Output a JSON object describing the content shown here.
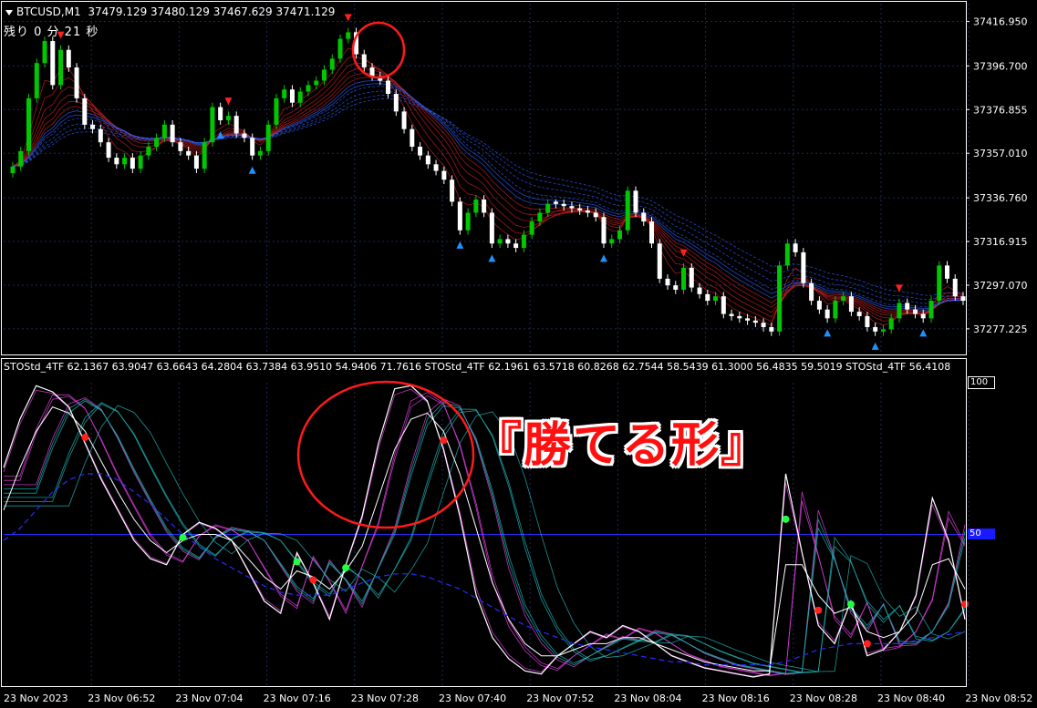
{
  "header": {
    "symbol": "BTCUSD,M1",
    "ohlc": "37479.129 37480.129 37467.629 37471.129",
    "timer": "残り 0 分 21 秒"
  },
  "indicator_header": {
    "text": "STOStd_4TF 62.1367 63.9047 63.6643 64.2804 63.7384 63.9510 54.9406 71.7616   STOStd_4TF 62.1961 63.5718 60.8268 62.7544 58.5439 61.3000 56.4835 59.5019   STOStd_4TF 56.4108"
  },
  "callout": {
    "text": "『勝てる形』"
  },
  "colors": {
    "bull_candle": "#00c800",
    "bear_candle": "#ffffff",
    "bear_ribbon": "#d02020",
    "bull_ribbon": "#3060ff",
    "osc_magenta": "#e040e0",
    "osc_teal": "#20b0b0",
    "sell_arrow": "#ff2020",
    "buy_arrow": "#2090ff",
    "grid": "#1c2a5a",
    "highlight_circle": "#ff1a1a"
  },
  "chart_data": [
    {
      "type": "candlestick",
      "title": "BTCUSD,M1",
      "ylim": [
        37266,
        37425
      ],
      "y_ticks": [
        "37416.950",
        "37396.700",
        "37376.855",
        "37357.010",
        "37336.760",
        "37316.915",
        "37297.070",
        "37277.225"
      ],
      "y_tick_values": [
        37416.95,
        37396.7,
        37376.855,
        37357.01,
        37336.76,
        37316.915,
        37297.07,
        37277.225
      ],
      "x_ticks": [
        "23 Nov 2023",
        "23 Nov 06:52",
        "23 Nov 07:04",
        "23 Nov 07:16",
        "23 Nov 07:28",
        "23 Nov 07:40",
        "23 Nov 07:52",
        "23 Nov 08:04",
        "23 Nov 08:16",
        "23 Nov 08:28",
        "23 Nov 08:40",
        "23 Nov 08:52"
      ],
      "close": [
        37351,
        37358,
        37382,
        37398,
        37408,
        37388,
        37404,
        37396,
        37382,
        37370,
        37368,
        37362,
        37355,
        37352,
        37355,
        37350,
        37356,
        37360,
        37364,
        37370,
        37362,
        37358,
        37356,
        37350,
        37362,
        37378,
        37372,
        37374,
        37366,
        37364,
        37356,
        37358,
        37370,
        37382,
        37386,
        37380,
        37385,
        37388,
        37390,
        37395,
        37400,
        37409,
        37412,
        37402,
        37396,
        37392,
        37390,
        37384,
        37376,
        37368,
        37360,
        37356,
        37352,
        37349,
        37345,
        37335,
        37322,
        37330,
        37336,
        37330,
        37316,
        37318,
        37316,
        37314,
        37320,
        37326,
        37330,
        37334,
        37334,
        37333,
        37332,
        37331,
        37330,
        37328,
        37316,
        37318,
        37322,
        37340,
        37330,
        37326,
        37316,
        37300,
        37297,
        37295,
        37305,
        37296,
        37293,
        37290,
        37292,
        37284,
        37283,
        37282,
        37281,
        37280,
        37278,
        37276,
        37306,
        37316,
        37312,
        37298,
        37290,
        37286,
        37282,
        37290,
        37292,
        37285,
        37283,
        37278,
        37276,
        37277,
        37282,
        37289,
        37286,
        37284,
        37282,
        37290,
        37306,
        37300,
        37292,
        37290
      ],
      "direction": [
        "bull",
        "bull",
        "bull",
        "bull",
        "bull",
        "bear",
        "bull",
        "bear",
        "bear",
        "bear",
        "bear",
        "bear",
        "bear",
        "bear",
        "bull",
        "bear",
        "bull",
        "bull",
        "bull",
        "bull",
        "bear",
        "bear",
        "bear",
        "bear",
        "bull",
        "bull",
        "bear",
        "bull",
        "bear",
        "bear",
        "bear",
        "bull",
        "bull",
        "bull",
        "bull",
        "bear",
        "bull",
        "bull",
        "bull",
        "bull",
        "bull",
        "bull",
        "bull",
        "bear",
        "bear",
        "bear",
        "bear",
        "bear",
        "bear",
        "bear",
        "bear",
        "bear",
        "bear",
        "bear",
        "bear",
        "bear",
        "bear",
        "bull",
        "bull",
        "bear",
        "bear",
        "bull",
        "bear",
        "bear",
        "bull",
        "bull",
        "bull",
        "bull",
        "bear",
        "bear",
        "bear",
        "bear",
        "bear",
        "bear",
        "bear",
        "bull",
        "bull",
        "bull",
        "bear",
        "bear",
        "bear",
        "bear",
        "bear",
        "bear",
        "bull",
        "bear",
        "bear",
        "bear",
        "bull",
        "bear",
        "bear",
        "bear",
        "bear",
        "bear",
        "bear",
        "bear",
        "bull",
        "bull",
        "bear",
        "bear",
        "bear",
        "bear",
        "bear",
        "bull",
        "bull",
        "bear",
        "bear",
        "bear",
        "bear",
        "bull",
        "bull",
        "bull",
        "bear",
        "bear",
        "bear",
        "bull",
        "bull",
        "bear",
        "bear",
        "bear"
      ]
    },
    {
      "type": "line",
      "title": "STOStd_4TF",
      "ylim": [
        0,
        100
      ],
      "levels": [
        "100",
        "50"
      ],
      "level_values": [
        100,
        50
      ],
      "x_ticks": [
        "23 Nov 2023",
        "23 Nov 06:52",
        "23 Nov 07:04",
        "23 Nov 07:16",
        "23 Nov 07:28",
        "23 Nov 07:40",
        "23 Nov 07:52",
        "23 Nov 08:04",
        "23 Nov 08:16",
        "23 Nov 08:28",
        "23 Nov 08:40",
        "23 Nov 08:52"
      ],
      "fast_line": [
        72,
        88,
        99,
        97,
        92,
        80,
        68,
        58,
        48,
        42,
        40,
        50,
        54,
        52,
        48,
        38,
        28,
        24,
        44,
        34,
        22,
        40,
        56,
        80,
        98,
        99,
        94,
        78,
        56,
        30,
        16,
        9,
        5,
        4,
        10,
        14,
        18,
        16,
        20,
        18,
        14,
        10,
        8,
        6,
        5,
        4,
        3,
        4,
        70,
        44,
        20,
        14,
        28,
        10,
        12,
        18,
        30,
        62,
        48,
        22
      ],
      "slow_line": [
        58,
        72,
        84,
        92,
        90,
        84,
        74,
        64,
        55,
        48,
        44,
        48,
        50,
        50,
        48,
        42,
        36,
        32,
        38,
        36,
        32,
        38,
        46,
        62,
        78,
        88,
        90,
        84,
        70,
        52,
        34,
        22,
        14,
        10,
        10,
        12,
        14,
        14,
        16,
        16,
        14,
        12,
        10,
        8,
        7,
        6,
        5,
        5,
        40,
        40,
        30,
        24,
        26,
        18,
        16,
        18,
        24,
        40,
        42,
        32
      ],
      "signal_line": [
        48,
        52,
        58,
        64,
        68,
        70,
        70,
        68,
        64,
        60,
        55,
        50,
        46,
        42,
        39,
        36,
        33,
        31,
        30,
        30,
        30,
        32,
        34,
        36,
        37,
        37,
        36,
        34,
        32,
        29,
        26,
        23,
        20,
        18,
        16,
        14,
        13,
        12,
        11,
        10,
        9,
        8,
        8,
        7,
        7,
        7,
        7,
        7,
        8,
        10,
        12,
        13,
        14,
        14,
        14,
        14,
        15,
        16,
        17,
        18
      ]
    }
  ]
}
